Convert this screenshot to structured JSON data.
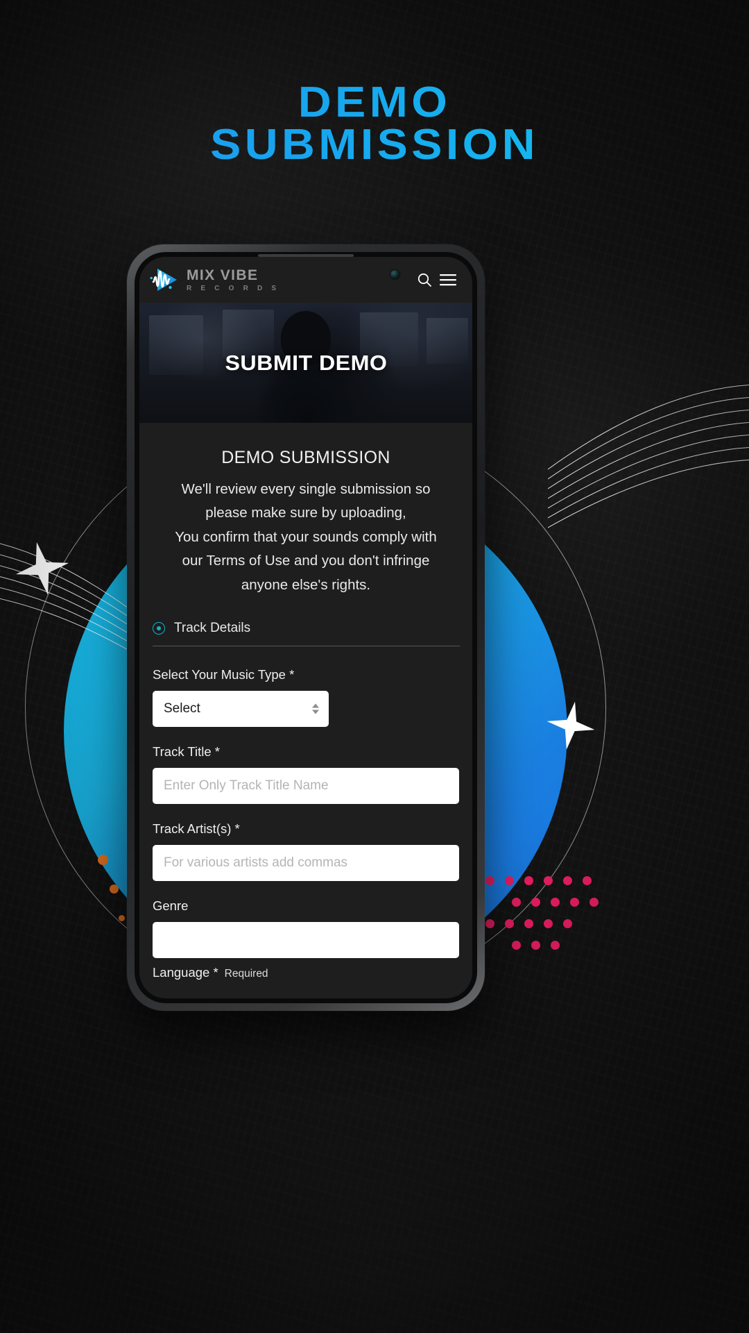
{
  "poster": {
    "title_line1": "DEMO",
    "title_line2": "SUBMISSION",
    "accent_color": "#14a9ef"
  },
  "phone": {
    "appbar": {
      "logo_name": "MIX VIBE",
      "logo_sub": "R E C O R D S",
      "search_icon": "search-icon",
      "menu_icon": "hamburger-menu-icon"
    },
    "hero": {
      "title": "SUBMIT DEMO"
    },
    "content": {
      "heading": "DEMO SUBMISSION",
      "paragraph_line1": "We'll review every single submission so",
      "paragraph_line2": "please make sure by uploading,",
      "paragraph_line3": "You confirm that your sounds comply with",
      "paragraph_line4": "our Terms of Use and you don't infringe",
      "paragraph_line5": "anyone else's rights.",
      "section_label": "Track Details",
      "section_icon": "radio-selected-icon",
      "section_icon_color": "#12b2c4"
    },
    "form": {
      "fields": [
        {
          "label": "Select Your Music Type *",
          "type": "select",
          "value": "Select",
          "name": "music-type-select"
        },
        {
          "label": "Track Title *",
          "type": "text",
          "value": "",
          "placeholder": "Enter Only Track Title Name",
          "name": "track-title-input"
        },
        {
          "label": "Track Artist(s) *",
          "type": "text",
          "value": "",
          "placeholder": "For various artists add commas",
          "name": "track-artists-input"
        },
        {
          "label": "Genre",
          "type": "text",
          "value": "",
          "placeholder": "",
          "name": "genre-input"
        }
      ],
      "language_label": "Language *",
      "language_required": "Required"
    }
  }
}
